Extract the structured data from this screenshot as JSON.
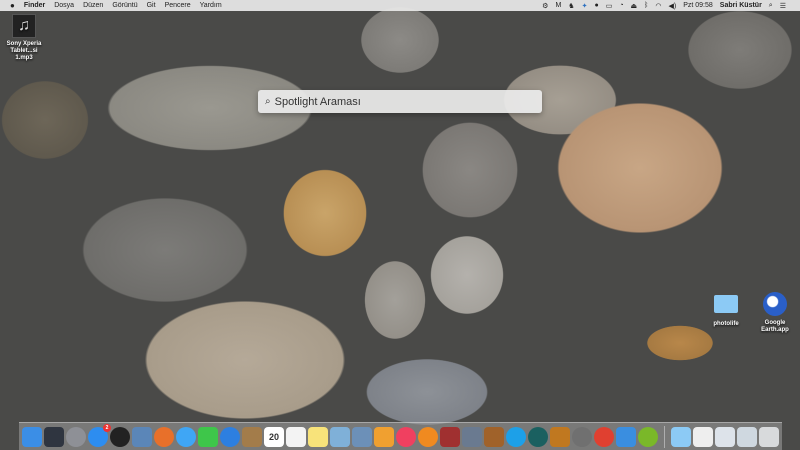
{
  "menubar": {
    "apple": "",
    "app": "Finder",
    "items": [
      "Dosya",
      "Düzen",
      "Görüntü",
      "Git",
      "Pencere",
      "Yardım"
    ],
    "clock": "Pzt 09:58",
    "user": "Sabri Küstür"
  },
  "desktop": {
    "items": [
      {
        "label1": "Sony Xperia",
        "label2": "Tablet...si 1.mp3",
        "icon": "music-file-icon"
      },
      {
        "label1": "photolife",
        "icon": "folder-icon"
      },
      {
        "label1": "Google",
        "label2": "Earth.app",
        "icon": "google-earth-icon"
      }
    ]
  },
  "spotlight": {
    "placeholder": "Spotlight Araması"
  },
  "dock": {
    "calendar_day": "20",
    "appstore_badge": "2",
    "apps": [
      "finder",
      "mission-control",
      "launchpad",
      "app-store",
      "dashboard",
      "preview",
      "firefox",
      "messages",
      "facetime",
      "safari",
      "contacts",
      "calendar",
      "reminders",
      "notes",
      "maps",
      "iphoto",
      "pages",
      "itunes",
      "ibooks",
      "photo-booth",
      "aperture",
      "garageband",
      "skype",
      "time-machine",
      "cat-app",
      "system-preferences",
      "chrome",
      "twitter",
      "spotify"
    ],
    "colors": [
      "#3b8ee6",
      "#2f3540",
      "#8e9096",
      "#2d8df0",
      "#222",
      "#5b86b8",
      "#e8702a",
      "#3fa6f5",
      "#3ec64a",
      "#2d7fe0",
      "#a37c4a",
      "#fff",
      "#f3f3f3",
      "#f8e37a",
      "#7fb0d8",
      "#6c90b8",
      "#f0a030",
      "#f04060",
      "#f08a20",
      "#a03030",
      "#6a7a90",
      "#a0622a",
      "#1da0e8",
      "#1a6060",
      "#c07820",
      "#707070",
      "#e04030",
      "#3a8ee0",
      "#7ab829"
    ],
    "stacks": [
      "folder",
      "document",
      "screenshots",
      "screenshots-2",
      "trash"
    ]
  }
}
